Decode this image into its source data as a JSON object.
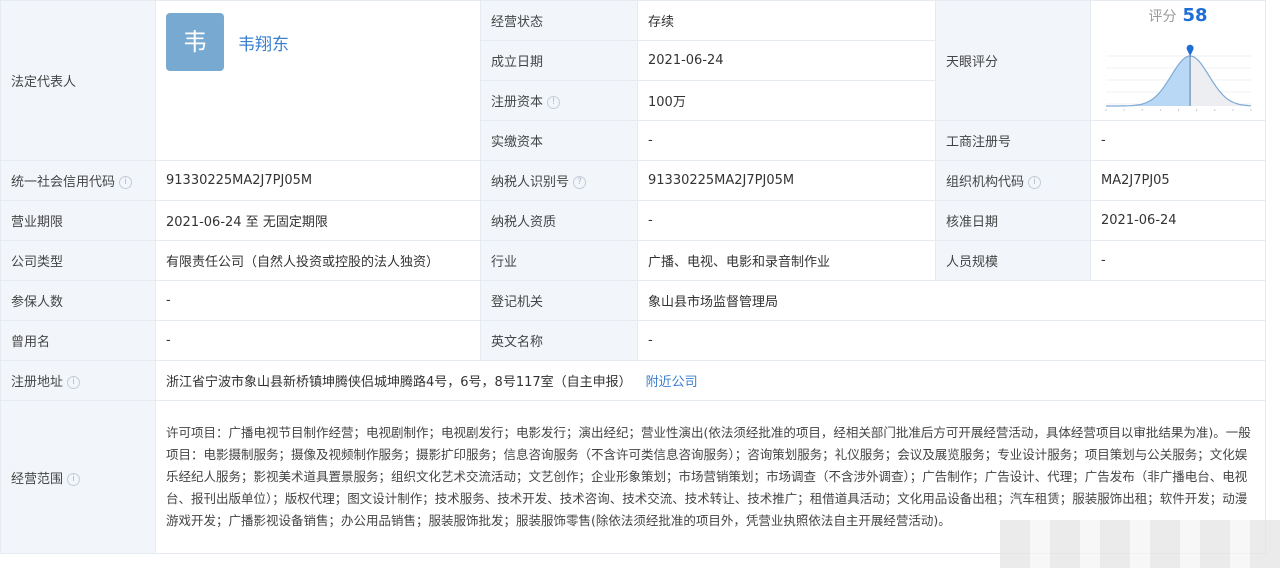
{
  "legal_rep": {
    "label": "法定代表人",
    "avatar_char": "韦",
    "name": "韦翔东"
  },
  "rows": {
    "status": {
      "label": "经营状态",
      "value": "存续"
    },
    "founded": {
      "label": "成立日期",
      "value": "2021-06-24"
    },
    "reg_capital": {
      "label": "注册资本",
      "value": "100万"
    },
    "paid_capital": {
      "label": "实缴资本",
      "value": "-"
    },
    "biz_reg_no": {
      "label": "工商注册号",
      "value": "-"
    },
    "credit_code": {
      "label": "统一社会信用代码",
      "value": "91330225MA2J7PJ05M"
    },
    "taxpayer_id": {
      "label": "纳税人识别号",
      "value": "91330225MA2J7PJ05M"
    },
    "org_code": {
      "label": "组织机构代码",
      "value": "MA2J7PJ05"
    },
    "term": {
      "label": "营业期限",
      "value": "2021-06-24 至 无固定期限"
    },
    "taxpayer_qual": {
      "label": "纳税人资质",
      "value": "-"
    },
    "approve_date": {
      "label": "核准日期",
      "value": "2021-06-24"
    },
    "company_type": {
      "label": "公司类型",
      "value": "有限责任公司（自然人投资或控股的法人独资）"
    },
    "industry": {
      "label": "行业",
      "value": "广播、电视、电影和录音制作业"
    },
    "staff_size": {
      "label": "人员规模",
      "value": "-"
    },
    "insured": {
      "label": "参保人数",
      "value": "-"
    },
    "authority": {
      "label": "登记机关",
      "value": "象山县市场监督管理局"
    },
    "former_name": {
      "label": "曾用名",
      "value": "-"
    },
    "english_name": {
      "label": "英文名称",
      "value": "-"
    },
    "address": {
      "label": "注册地址",
      "value": "浙江省宁波市象山县新桥镇坤腾侠侣城坤腾路4号，6号，8号117室（自主申报）",
      "link": "附近公司"
    },
    "scope": {
      "label": "经营范围",
      "value": "许可项目：广播电视节目制作经营；电视剧制作；电视剧发行；电影发行；演出经纪；营业性演出(依法须经批准的项目，经相关部门批准后方可开展经营活动，具体经营项目以审批结果为准)。一般项目：电影摄制服务；摄像及视频制作服务；摄影扩印服务；信息咨询服务（不含许可类信息咨询服务）；咨询策划服务；礼仪服务；会议及展览服务；专业设计服务；项目策划与公关服务；文化娱乐经纪人服务；影视美术道具置景服务；组织文化艺术交流活动；文艺创作；企业形象策划；市场营销策划；市场调查（不含涉外调查）；广告制作；广告设计、代理；广告发布（非广播电台、电视台、报刊出版单位）；版权代理；图文设计制作；技术服务、技术开发、技术咨询、技术交流、技术转让、技术推广；租借道具活动；文化用品设备出租；汽车租赁；服装服饰出租；软件开发；动漫游戏开发；广播影视设备销售；办公用品销售；服装服饰批发；服装服饰零售(除依法须经批准的项目外，凭营业执照依法自主开展经营活动)。"
    }
  },
  "score": {
    "label": "天眼评分",
    "title": "评分",
    "value": 58,
    "max": 100,
    "accent": "#1e6ed6"
  }
}
